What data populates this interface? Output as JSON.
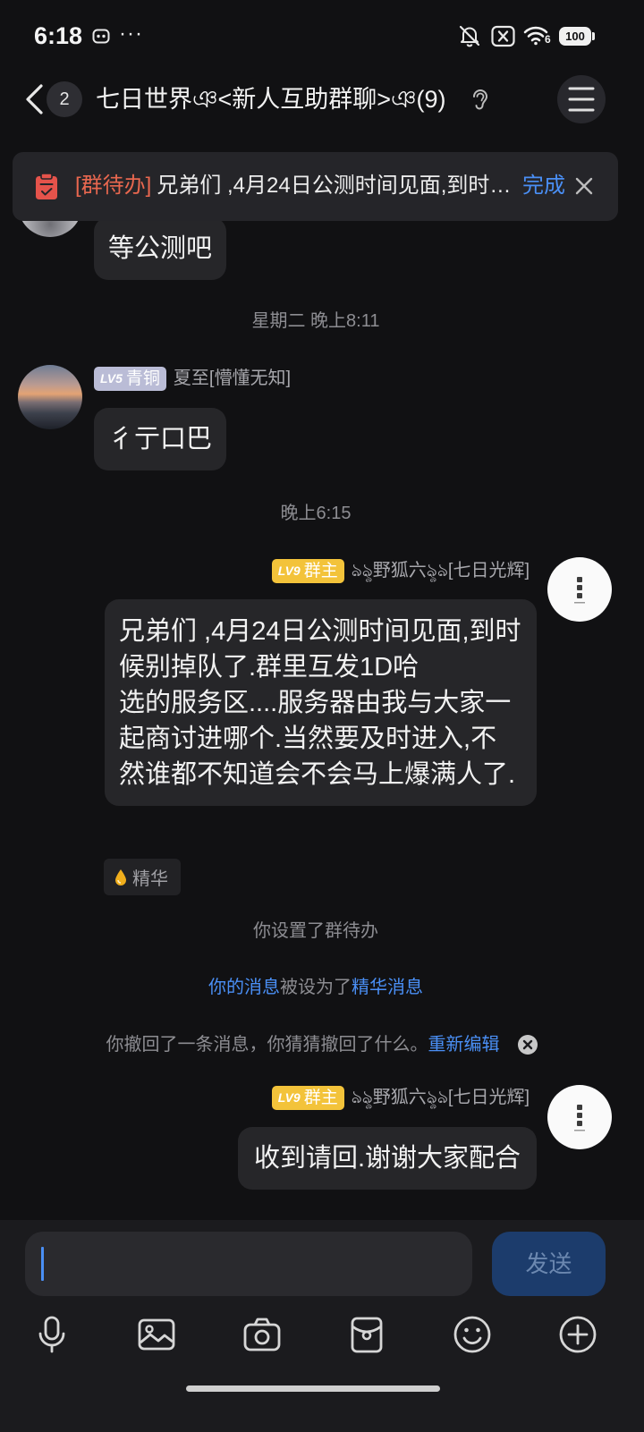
{
  "status_bar": {
    "time": "6:18",
    "overflow": "···",
    "wifi_generation": "6",
    "battery": "100"
  },
  "header": {
    "unread_count": "2",
    "title": "七日世界ঞ<新人互助群聊>ঞ(9)"
  },
  "pinned_todo": {
    "tag": "[群待办]",
    "text": "兄弟们 ,4月24日公测时间见面,到时…",
    "done": "完成"
  },
  "chat": {
    "partial_message": {
      "text": "等公测吧"
    },
    "timestamp_1": "星期二 晚上8:11",
    "message_1": {
      "level": "LV5",
      "title": "青铜",
      "name": "夏至[懵懂无知]",
      "text": "彳亍口巴"
    },
    "timestamp_2": "晚上6:15",
    "message_2": {
      "level": "LV9",
      "title": "群主",
      "name": "ঌৡ野狐六ৡঌ[七日光辉]",
      "text": "兄弟们 ,4月24日公测时间见面,到时候别掉队了.群里互发1D哈\n选的服务区....服务器由我与大家一起商讨进哪个.当然要及时进入,不然谁都不知道会不会马上爆满人了.",
      "tag": "精华"
    },
    "system_1": "你设置了群待办",
    "system_2": {
      "part1": "你的消息",
      "part2": "被设为了",
      "part3": "精华消息"
    },
    "system_3": {
      "text": "你撤回了一条消息，你猜猜撤回了什么。",
      "action": "重新编辑"
    },
    "message_3": {
      "level": "LV9",
      "title": "群主",
      "name": "ঌৡ野狐六ৡঌ[七日光辉]",
      "text": "收到请回.谢谢大家配合"
    }
  },
  "composer": {
    "send": "发送"
  },
  "toolbar": {
    "icons": [
      "mic-icon",
      "image-icon",
      "camera-icon",
      "red-packet-icon",
      "emoji-icon",
      "add-icon"
    ]
  },
  "colors": {
    "background": "#111113",
    "bubble": "#262629",
    "accent": "#4a8ff5",
    "todo_tag": "#e8674f",
    "owner_badge": "#f3c33a",
    "level_badge": "#babcd6",
    "essence_drop": "#f0ae1c",
    "send_button": "#1c3c6c"
  }
}
